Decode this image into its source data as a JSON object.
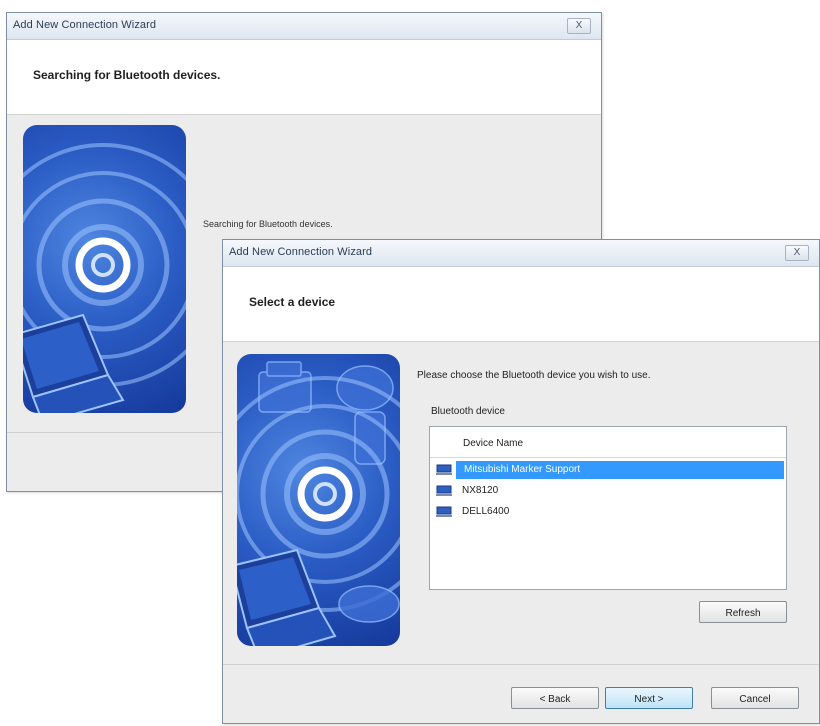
{
  "back_window": {
    "title": "Add New Connection Wizard",
    "close_label": "X",
    "heading": "Searching for Bluetooth devices.",
    "status_text": "Searching for Bluetooth devices.",
    "art_icon": "bluetooth-signal-laptop-illustration"
  },
  "front_window": {
    "title": "Add New Connection Wizard",
    "close_label": "X",
    "heading": "Select a device",
    "instruction": "Please choose the Bluetooth device you wish to use.",
    "group_label": "Bluetooth device",
    "list": {
      "column_header": "Device Name",
      "rows": [
        {
          "label": "Mitsubishi Marker Support",
          "icon": "computer-icon",
          "selected": true
        },
        {
          "label": "NX8120",
          "icon": "computer-icon",
          "selected": false
        },
        {
          "label": "DELL6400",
          "icon": "computer-icon",
          "selected": false
        }
      ]
    },
    "buttons": {
      "refresh": "Refresh",
      "back": "< Back",
      "next": "Next >",
      "cancel": "Cancel"
    },
    "art_icon": "bluetooth-signal-devices-illustration"
  },
  "colors": {
    "selection": "#3399ff",
    "art_blue": "#2a5cc4",
    "titlebar": "#dde6f0"
  }
}
